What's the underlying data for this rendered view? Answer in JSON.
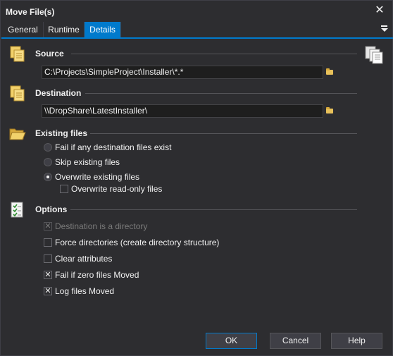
{
  "window": {
    "title": "Move File(s)",
    "close_glyph": "✕"
  },
  "tabs": [
    {
      "label": "General",
      "active": false
    },
    {
      "label": "Runtime",
      "active": false
    },
    {
      "label": "Details",
      "active": true
    }
  ],
  "source": {
    "heading": "Source",
    "path": "C:\\Projects\\SimpleProject\\Installer\\*.*"
  },
  "destination": {
    "heading": "Destination",
    "path": "\\\\DropShare\\LatestInstaller\\"
  },
  "existing_files": {
    "heading": "Existing files",
    "options": [
      {
        "label": "Fail if any destination files exist",
        "selected": false
      },
      {
        "label": "Skip existing files",
        "selected": false
      },
      {
        "label": "Overwrite existing files",
        "selected": true
      }
    ],
    "overwrite_readonly": {
      "label": "Overwrite read-only files",
      "checked": false
    }
  },
  "options": {
    "heading": "Options",
    "items": [
      {
        "label": "Destination is a directory",
        "checked": true,
        "disabled": true
      },
      {
        "label": "Force directories (create directory structure)",
        "checked": false,
        "disabled": false
      },
      {
        "label": "Clear attributes",
        "checked": false,
        "disabled": false
      },
      {
        "label": "Fail if zero files Moved",
        "checked": true,
        "disabled": false
      },
      {
        "label": "Log files Moved",
        "checked": true,
        "disabled": false
      }
    ]
  },
  "buttons": {
    "ok": "OK",
    "cancel": "Cancel",
    "help": "Help"
  },
  "colors": {
    "background": "#2d2d30",
    "accent": "#007acc",
    "field_bg": "#1e1e1e"
  },
  "icons": {
    "source": "files-icon",
    "destination": "files-icon",
    "existing_files": "open-folder-icon",
    "options": "checklist-icon",
    "source_side": "documents-stack-icon"
  }
}
